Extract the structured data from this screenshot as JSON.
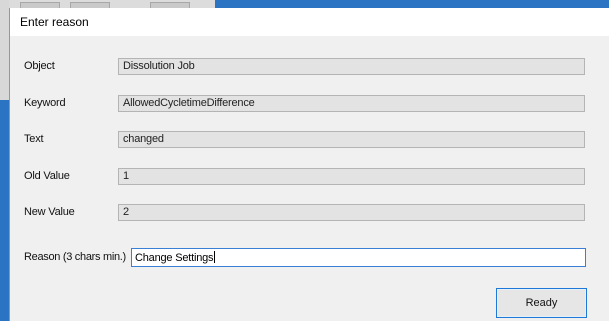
{
  "dialog": {
    "title": "Enter reason"
  },
  "fields": {
    "object": {
      "label": "Object",
      "value": "Dissolution Job"
    },
    "keyword": {
      "label": "Keyword",
      "value": "AllowedCycletimeDifference"
    },
    "text": {
      "label": "Text",
      "value": "changed"
    },
    "old_value": {
      "label": "Old Value",
      "value": "1"
    },
    "new_value": {
      "label": "New Value",
      "value": "2"
    }
  },
  "reason": {
    "label": "Reason (3 chars min.)",
    "value": "Change Settings"
  },
  "buttons": {
    "ready_label": "Ready"
  },
  "colors": {
    "desktop": "#2b74c4",
    "dialog_bg": "#f0f0f0",
    "focus_border": "#1e78d7"
  }
}
